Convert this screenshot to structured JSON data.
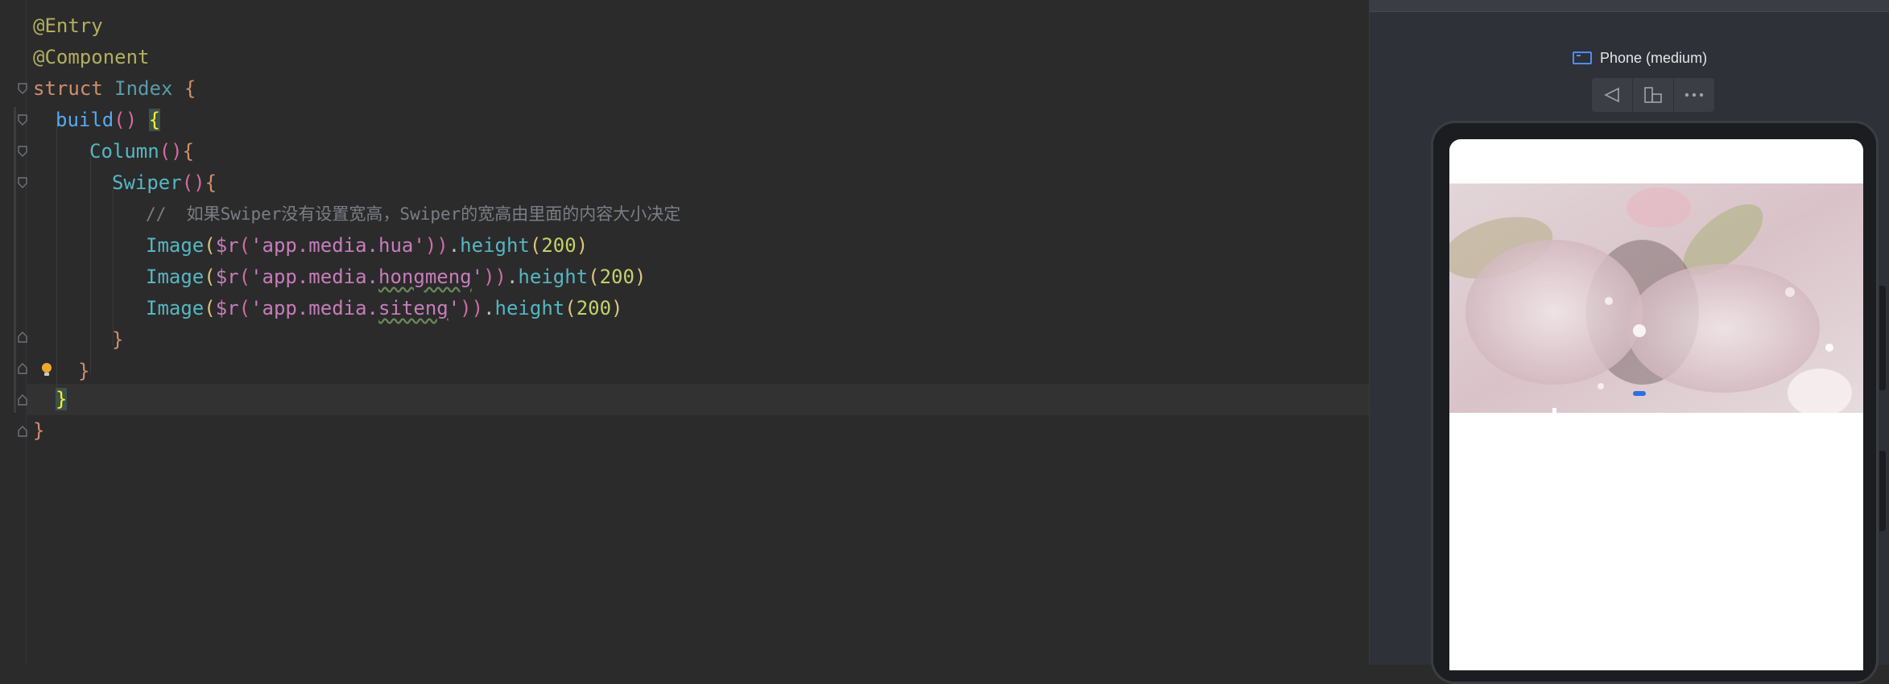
{
  "editor": {
    "lines": {
      "l1": {
        "ann": "@Entry"
      },
      "l2": {
        "ann": "@Component"
      },
      "l3": {
        "kw": "struct",
        "cls": "Index",
        "brace": "{"
      },
      "l4": {
        "fn": "build",
        "paren": "()",
        "brace": "{"
      },
      "l5": {
        "fn": "Column",
        "paren": "()",
        "brace": "{"
      },
      "l6": {
        "fn": "Swiper",
        "paren": "()",
        "brace": "{"
      },
      "l7": {
        "comment": "//  如果Swiper没有设置宽高，Swiper的宽高由里面的内容大小决定"
      },
      "l8": {
        "fn": "Image",
        "p1": "(",
        "sym": "$r",
        "p2": "(",
        "str": "'app.media.hua'",
        "p3": "))",
        "dot": ".",
        "method": "height",
        "p4": "(",
        "num": "200",
        "p5": ")"
      },
      "l9": {
        "fn": "Image",
        "p1": "(",
        "sym": "$r",
        "p2": "(",
        "str_a": "'app.media.",
        "str_b": "hongmeng",
        "str_c": "'",
        "p3": "))",
        "dot": ".",
        "method": "height",
        "p4": "(",
        "num": "200",
        "p5": ")"
      },
      "l10": {
        "fn": "Image",
        "p1": "(",
        "sym": "$r",
        "p2": "(",
        "str_a": "'app.media.",
        "str_b": "siteng",
        "str_c": "'",
        "p3": "))",
        "dot": ".",
        "method": "height",
        "p4": "(",
        "num": "200",
        "p5": ")"
      },
      "l11": {
        "brace": "}"
      },
      "l12": {
        "brace": "}"
      },
      "l13": {
        "brace": "}"
      },
      "l14": {
        "brace": "}"
      }
    }
  },
  "preview": {
    "device_label": "Phone (medium)",
    "toolbar": {
      "back_icon": "triangle-back-icon",
      "rotate_icon": "rotate-device-icon",
      "more_icon": "more-icon"
    },
    "swiper_indicator_color": "#2f6fe4"
  }
}
